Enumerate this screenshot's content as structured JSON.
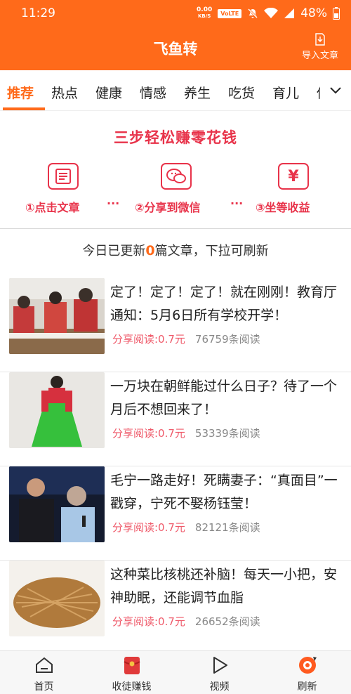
{
  "status_bar": {
    "time": "11:29",
    "net_speed_value": "0.00",
    "net_speed_unit": "KB/S",
    "volte": "VoLTE",
    "battery": "48%"
  },
  "header": {
    "title": "飞鱼转",
    "import_label": "导入文章"
  },
  "tabs": [
    {
      "label": "推荐",
      "active": true
    },
    {
      "label": "热点",
      "active": false
    },
    {
      "label": "健康",
      "active": false
    },
    {
      "label": "情感",
      "active": false
    },
    {
      "label": "养生",
      "active": false
    },
    {
      "label": "吃货",
      "active": false
    },
    {
      "label": "育儿",
      "active": false
    },
    {
      "label": "传",
      "active": false
    }
  ],
  "promo": {
    "title": "三步轻松赚零花钱",
    "steps": [
      {
        "label": "①点击文章",
        "icon": "article-icon"
      },
      {
        "label": "②分享到微信",
        "icon": "wechat-icon"
      },
      {
        "label": "③坐等收益",
        "icon": "yuan-icon"
      }
    ],
    "separator": "···"
  },
  "update_notice": {
    "prefix": "今日已更新",
    "count": "0",
    "suffix": "篇文章，下拉可刷新"
  },
  "articles": [
    {
      "title": "定了！定了！定了！就在刚刚！教育厅通知：5月6日所有学校开学！",
      "reward": "分享阅读:0.7元",
      "reads": "76759条阅读"
    },
    {
      "title": "一万块在朝鲜能过什么日子？待了一个月后不想回来了！",
      "reward": "分享阅读:0.7元",
      "reads": "53339条阅读"
    },
    {
      "title": "毛宁一路走好！死瞒妻子：“真面目”一戳穿，宁死不娶杨钰莹！",
      "reward": "分享阅读:0.7元",
      "reads": "82121条阅读"
    },
    {
      "title": "这种菜比核桃还补脑！每天一小把，安神助眠，还能调节血脂",
      "reward": "分享阅读:0.7元",
      "reads": "26652条阅读"
    }
  ],
  "bottom_nav": [
    {
      "label": "首页",
      "icon": "home-icon"
    },
    {
      "label": "收徒赚钱",
      "icon": "red-envelope-icon"
    },
    {
      "label": "视频",
      "icon": "play-icon"
    },
    {
      "label": "刷新",
      "icon": "refresh-icon"
    }
  ],
  "colors": {
    "brand": "#ff6a1a",
    "promo_red": "#e8334a",
    "reward_red": "#ef5a6a"
  }
}
